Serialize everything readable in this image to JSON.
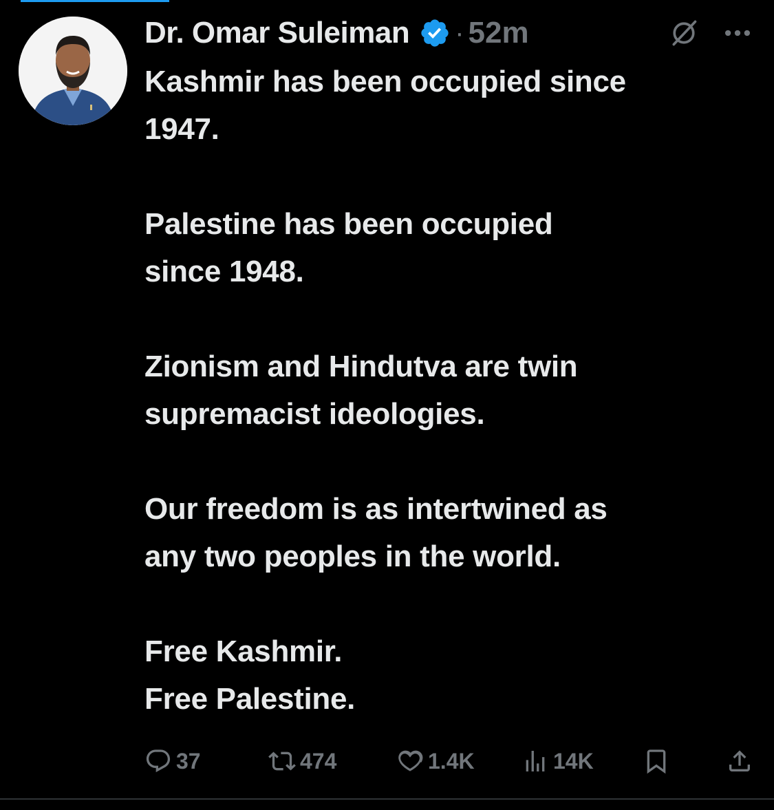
{
  "tweet": {
    "author": {
      "display_name": "Dr. Omar Suleiman",
      "verified": true,
      "avatar": "profile-photo"
    },
    "separator": "·",
    "timestamp": "52m",
    "paragraphs": [
      [
        "Kashmir has been occupied since",
        "1947."
      ],
      [
        "Palestine has been occupied",
        "since 1948."
      ],
      [
        "Zionism and Hindutva are twin",
        "supremacist ideologies."
      ],
      [
        "Our freedom is as intertwined as",
        "any two peoples in the world."
      ],
      [
        "Free Kashmir.",
        "Free Palestine."
      ]
    ],
    "stats": {
      "replies": "37",
      "reposts": "474",
      "likes": "1.4K",
      "views": "14K"
    }
  },
  "icons": {
    "verified": "verified-badge-icon",
    "grok": "grok-icon",
    "more": "more-icon",
    "reply": "reply-icon",
    "repost": "repost-icon",
    "like": "heart-icon",
    "views": "analytics-icon",
    "bookmark": "bookmark-icon",
    "share": "share-icon"
  },
  "colors": {
    "background": "#000000",
    "text": "#e7e9ea",
    "secondary": "#71767b",
    "accent": "#1d9bf0"
  }
}
